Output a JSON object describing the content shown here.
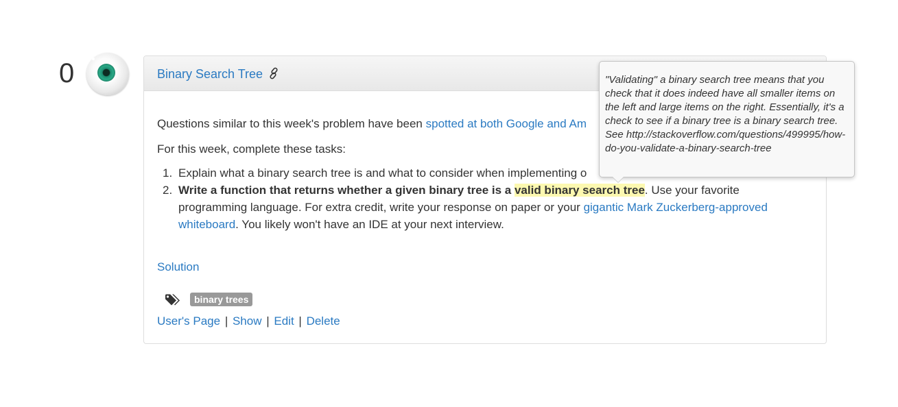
{
  "vote": {
    "count": "0"
  },
  "post": {
    "title": "Binary Search Tree",
    "intro_text": "Questions similar to this week's problem have been ",
    "intro_link": "spotted at both Google and Am",
    "tasks_heading": "For this week, complete these tasks:",
    "tasks": [
      {
        "num": "1.",
        "text": "Explain what a binary search tree is and what to consider when implementing o"
      },
      {
        "num": "2.",
        "bold_before": "Write a function that returns whether a given binary tree is a ",
        "bold_highlight": "valid binary search tree",
        "text_after": ". Use your favorite programming language. For extra credit, write your response on paper or your ",
        "link": "gigantic Mark Zuckerberg-approved whiteboard",
        "text_end": ". You likely won't have an IDE at your next interview."
      }
    ],
    "solution_link": "Solution",
    "tags": [
      "binary trees"
    ],
    "actions": {
      "users_page": "User's Page",
      "show": "Show",
      "edit": "Edit",
      "delete": "Delete",
      "separator": "|"
    }
  },
  "tooltip": {
    "text": "\"Validating\" a binary search tree means that you check that it does indeed have all smaller items on the left and large items on the right. Essentially, it's a check to see if a binary tree is a binary search tree. See http://stackoverflow.com/questions/499995/how-do-you-validate-a-binary-search-tree"
  },
  "colors": {
    "link": "#2a7ac2",
    "highlight": "#fcf8b0",
    "tag_bg": "#999999",
    "iris": "#1b8a6e"
  },
  "icons": {
    "permalink": "link-icon",
    "tags": "tags-icon",
    "avatar": "eyeball-avatar"
  }
}
